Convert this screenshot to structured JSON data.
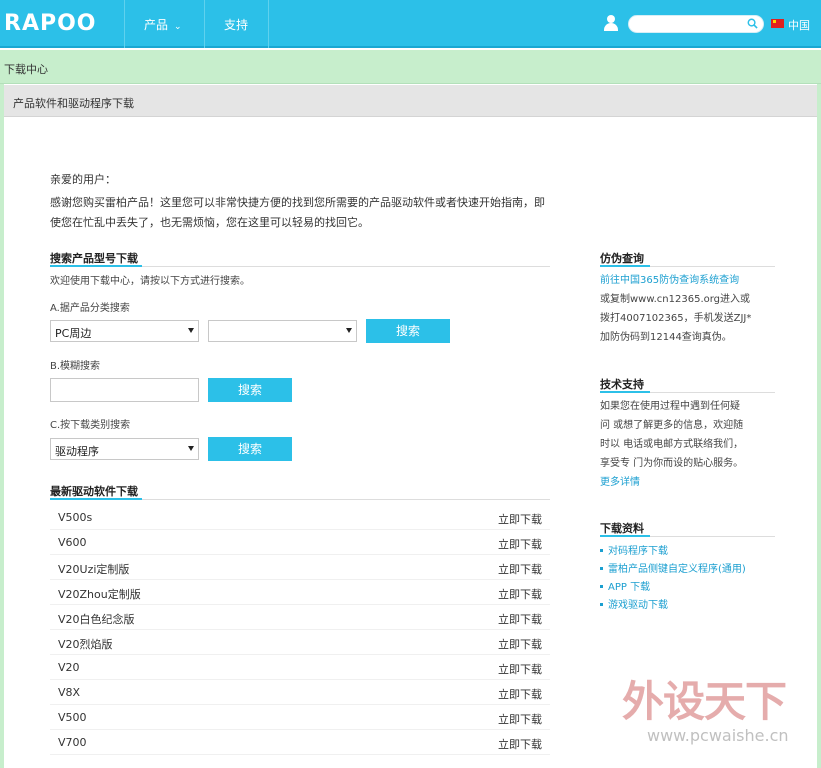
{
  "header": {
    "logo": "RAPOO",
    "nav": [
      {
        "label": "产品",
        "has_dropdown": true
      },
      {
        "label": "支持",
        "has_dropdown": false
      }
    ],
    "search_placeholder": "",
    "language": "中国"
  },
  "breadcrumb": "下载中心",
  "section_title": "产品软件和驱动程序下载",
  "greeting": "亲爱的用户：",
  "intro": "感谢您购买雷柏产品！这里您可以非常快捷方便的找到您所需要的产品驱动软件或者快速开始指南，即使您在忙乱中丢失了，也无需烦恼，您在这里可以轻易的找回它。",
  "search_section": {
    "title": "搜索产品型号下载",
    "subtitle": "欢迎使用下载中心，请按以下方式进行搜索。",
    "a_label": "A.据产品分类搜索",
    "a_select1": "PC周边",
    "a_select2": "",
    "b_label": "B.模糊搜索",
    "b_input": "",
    "c_label": "C.按下载类别搜索",
    "c_select": "驱动程序",
    "button": "搜索"
  },
  "latest_section": {
    "title": "最新驱动软件下载",
    "action_label": "立即下载",
    "items": [
      "V500s",
      "V600",
      "V20Uzi定制版",
      "V20Zhou定制版",
      "V20白色纪念版",
      "V20烈焰版",
      "V20",
      "V8X",
      "V500",
      "V700"
    ]
  },
  "sidebar": {
    "anti_fake": {
      "title": "仿伪查询",
      "link": "前往中国365防伪查询系统查询",
      "lines": [
        "或复制www.cn12365.org进入或",
        "拨打4007102365，手机发送ZJJ*",
        "加防伪码到12144查询真伪。"
      ]
    },
    "tech_support": {
      "title": "技术支持",
      "lines": [
        "如果您在使用过程中遇到任何疑",
        "问 或想了解更多的信息，欢迎随",
        "时以 电话或电邮方式联络我们，",
        "享受专 门为你而设的贴心服务。"
      ],
      "more": "更多详情"
    },
    "downloads": {
      "title": "下载资料",
      "items": [
        "对码程序下载",
        "雷柏产品侧键自定义程序(通用)",
        "APP 下载",
        "游戏驱动下载"
      ]
    }
  },
  "watermark": {
    "big": "外设天下",
    "url": "www.pcwaishe.cn"
  },
  "colors": {
    "accent": "#2cc0e8",
    "breadcrumb_bg": "#c7eecc",
    "link": "#1b9fd0"
  }
}
